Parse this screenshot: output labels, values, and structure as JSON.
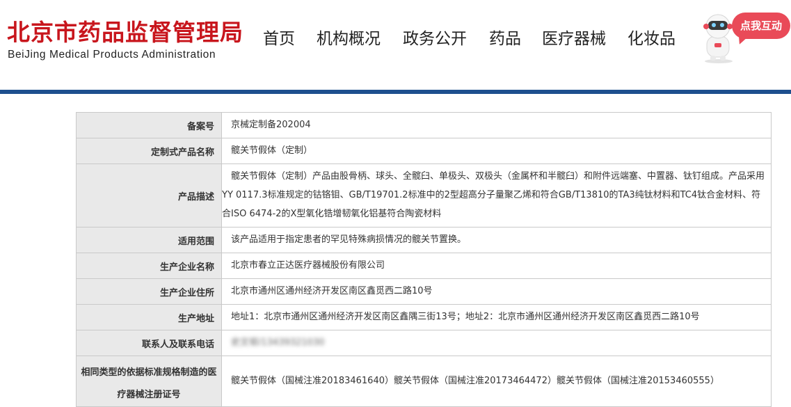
{
  "header": {
    "logo_cn": "北京市药品监督管理局",
    "logo_en": "BeiJing Medical Products Administration",
    "nav": [
      "首页",
      "机构概况",
      "政务公开",
      "药品",
      "医疗器械",
      "化妆品"
    ],
    "interact_label": "点我互动",
    "bar_color": "#1d4f8e",
    "brand_color": "#c8161d"
  },
  "record": {
    "rows": [
      {
        "label": "备案号",
        "value": "京械定制备202004"
      },
      {
        "label": "定制式产品名称",
        "value": "髋关节假体（定制）"
      },
      {
        "label": "产品描述",
        "value": "　髋关节假体（定制）产品由股骨柄、球头、全髋臼、单极头、双极头（金属杯和半髋臼）和附件远端塞、中置器、钛钉组成。产品采用YY 0117.3标准规定的钴铬钼、GB/T19701.2标准中的2型超高分子量聚乙烯和符合GB/T13810的TA3纯钛材料和TC4钛合金材料、符合ISO 6474-2的X型氧化锆增韧氧化铝基符合陶瓷材料"
      },
      {
        "label": "适用范围",
        "value": "该产品适用于指定患者的罕见特殊病损情况的髋关节置换。"
      },
      {
        "label": "生产企业名称",
        "value": "北京市春立正达医疗器械股份有限公司"
      },
      {
        "label": "生产企业住所",
        "value": "北京市通州区通州经济开发区南区鑫觅西二路10号"
      },
      {
        "label": "生产地址",
        "value": "地址1：北京市通州区通州经济开发区南区鑫隅三街13号；地址2：北京市通州区通州经济开发区南区鑫觅西二路10号"
      },
      {
        "label": "联系人及联系电话",
        "value": "史文邨/13439321030"
      },
      {
        "label": "相同类型的依据标准规格制造的医疗器械注册证号",
        "value": "髋关节假体（国械注准20183461640）髋关节假体（国械注准20173464472）髋关节假体（国械注准20153460555）"
      }
    ]
  }
}
